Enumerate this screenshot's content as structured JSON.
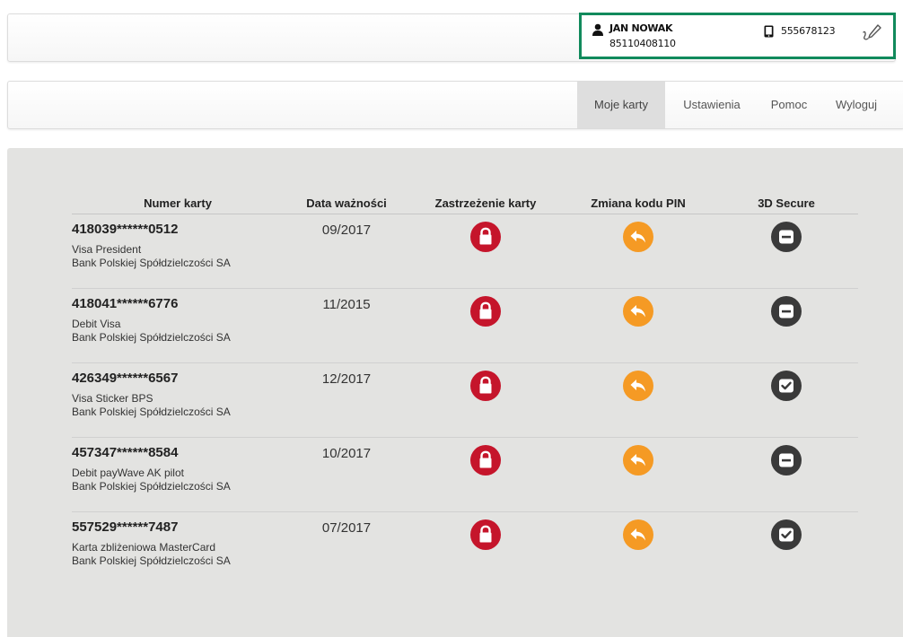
{
  "user": {
    "name": "JAN NOWAK",
    "id_number": "85110408110",
    "phone": "555678123",
    "icons": {
      "user": "user-icon",
      "phone": "phone-icon",
      "edit": "edit-signature-icon"
    },
    "highlight_color": "#118a5c"
  },
  "nav": {
    "items": [
      {
        "label": "Moje karty",
        "active": true
      },
      {
        "label": "Ustawienia",
        "active": false
      },
      {
        "label": "Pomoc",
        "active": false
      },
      {
        "label": "Wyloguj",
        "active": false
      }
    ]
  },
  "table": {
    "headers": {
      "number": "Numer karty",
      "expiry": "Data ważności",
      "block": "Zastrzeżenie karty",
      "pin": "Zmiana kodu PIN",
      "secure3d": "3D Secure"
    },
    "rows": [
      {
        "number": "418039******0512",
        "name": "Visa President",
        "bank": "Bank Polskiej Spółdzielczości SA",
        "expiry": "09/2017",
        "secure3d": "disabled"
      },
      {
        "number": "418041******6776",
        "name": "Debit Visa",
        "bank": "Bank Polskiej Spółdzielczości SA",
        "expiry": "11/2015",
        "secure3d": "disabled"
      },
      {
        "number": "426349******6567",
        "name": "Visa Sticker BPS",
        "bank": "Bank Polskiej Spółdzielczości SA",
        "expiry": "12/2017",
        "secure3d": "enabled"
      },
      {
        "number": "457347******8584",
        "name": "Debit payWave AK pilot",
        "bank": "Bank Polskiej Spółdzielczości SA",
        "expiry": "10/2017",
        "secure3d": "disabled"
      },
      {
        "number": "557529******7487",
        "name": "Karta zbliżeniowa MasterCard",
        "bank": "Bank Polskiej Spółdzielczości SA",
        "expiry": "07/2017",
        "secure3d": "enabled"
      }
    ]
  },
  "icons": {
    "block": "padlock-icon",
    "pin": "reply-arrow-icon",
    "secure3d_disabled": "minus-box-icon",
    "secure3d_enabled": "check-box-icon"
  },
  "colors": {
    "block_button": "#c5152b",
    "pin_button": "#f59a24",
    "secure3d_button": "#3a3a3a",
    "content_background": "#e3e3e1"
  }
}
